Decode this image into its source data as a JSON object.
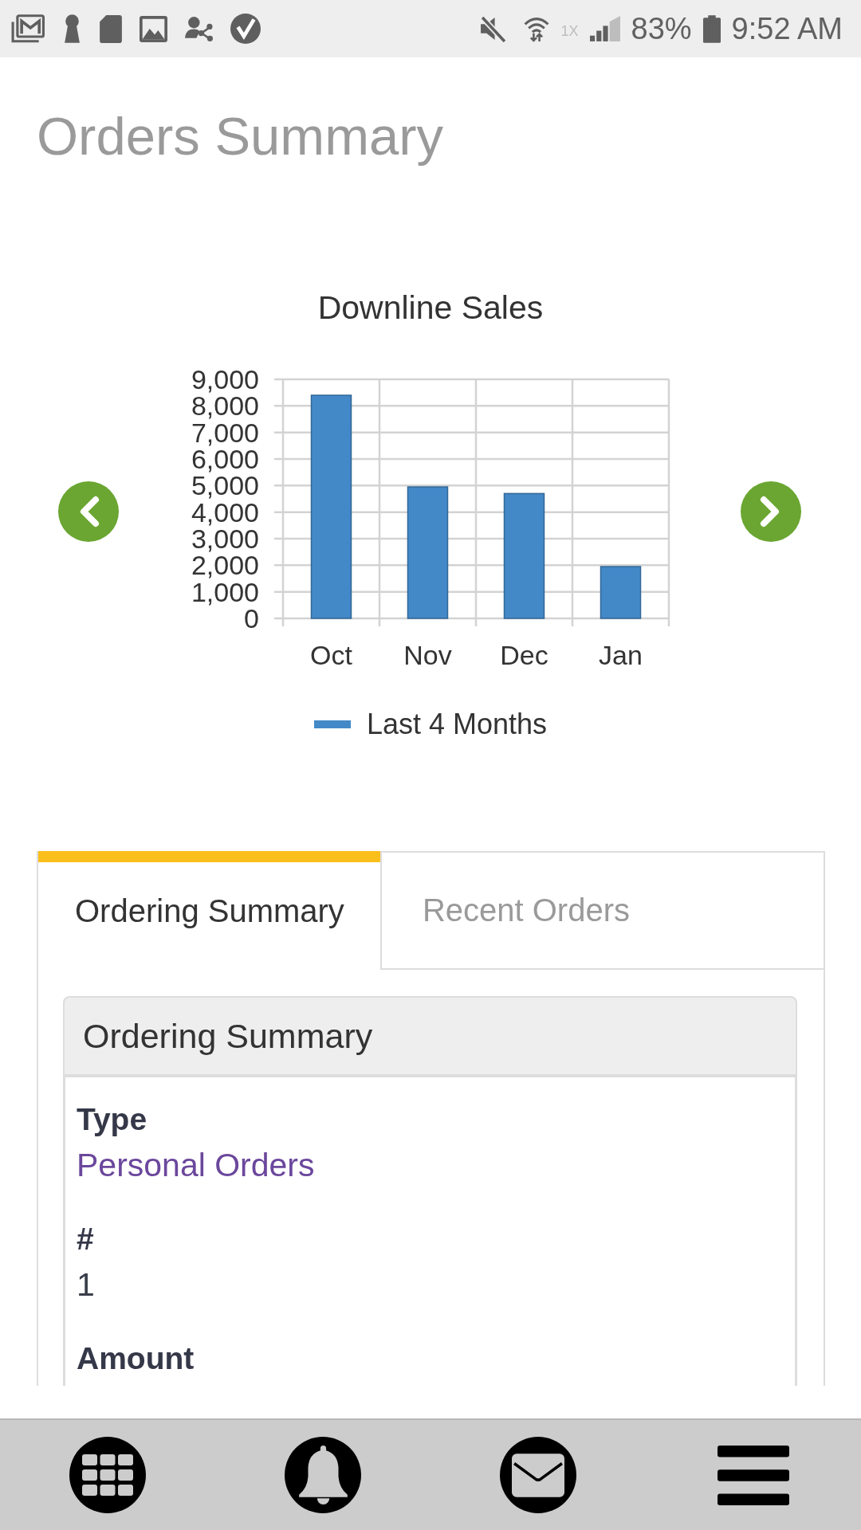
{
  "status_bar": {
    "network_type": "1X",
    "battery": "83%",
    "time": "9:52 AM"
  },
  "header": {
    "title": "Orders Summary"
  },
  "chart": {
    "chart_data": {
      "type": "bar",
      "title": "Downline Sales",
      "categories": [
        "Oct",
        "Nov",
        "Dec",
        "Jan"
      ],
      "series": [
        {
          "name": "Last 4 Months",
          "color": "#4389c8",
          "values": [
            8400,
            4950,
            4700,
            1950
          ]
        }
      ],
      "ylim": [
        0,
        9000
      ],
      "yticks": [
        {
          "value": 0,
          "label": "0"
        },
        {
          "value": 1000,
          "label": "1,000"
        },
        {
          "value": 2000,
          "label": "2,000"
        },
        {
          "value": 3000,
          "label": "3,000"
        },
        {
          "value": 4000,
          "label": "4,000"
        },
        {
          "value": 5000,
          "label": "5,000"
        },
        {
          "value": 6000,
          "label": "6,000"
        },
        {
          "value": 7000,
          "label": "7,000"
        },
        {
          "value": 8000,
          "label": "8,000"
        },
        {
          "value": 9000,
          "label": "9,000"
        }
      ],
      "grid": true
    }
  },
  "tabs": [
    {
      "label": "Ordering Summary",
      "selected": true
    },
    {
      "label": "Recent Orders",
      "selected": false
    }
  ],
  "panel": {
    "title": "Ordering Summary",
    "fields": [
      {
        "label": "Type",
        "value": "Personal Orders",
        "kind": "link"
      },
      {
        "label": "#",
        "value": "1",
        "kind": "text"
      },
      {
        "label": "Amount"
      }
    ]
  }
}
